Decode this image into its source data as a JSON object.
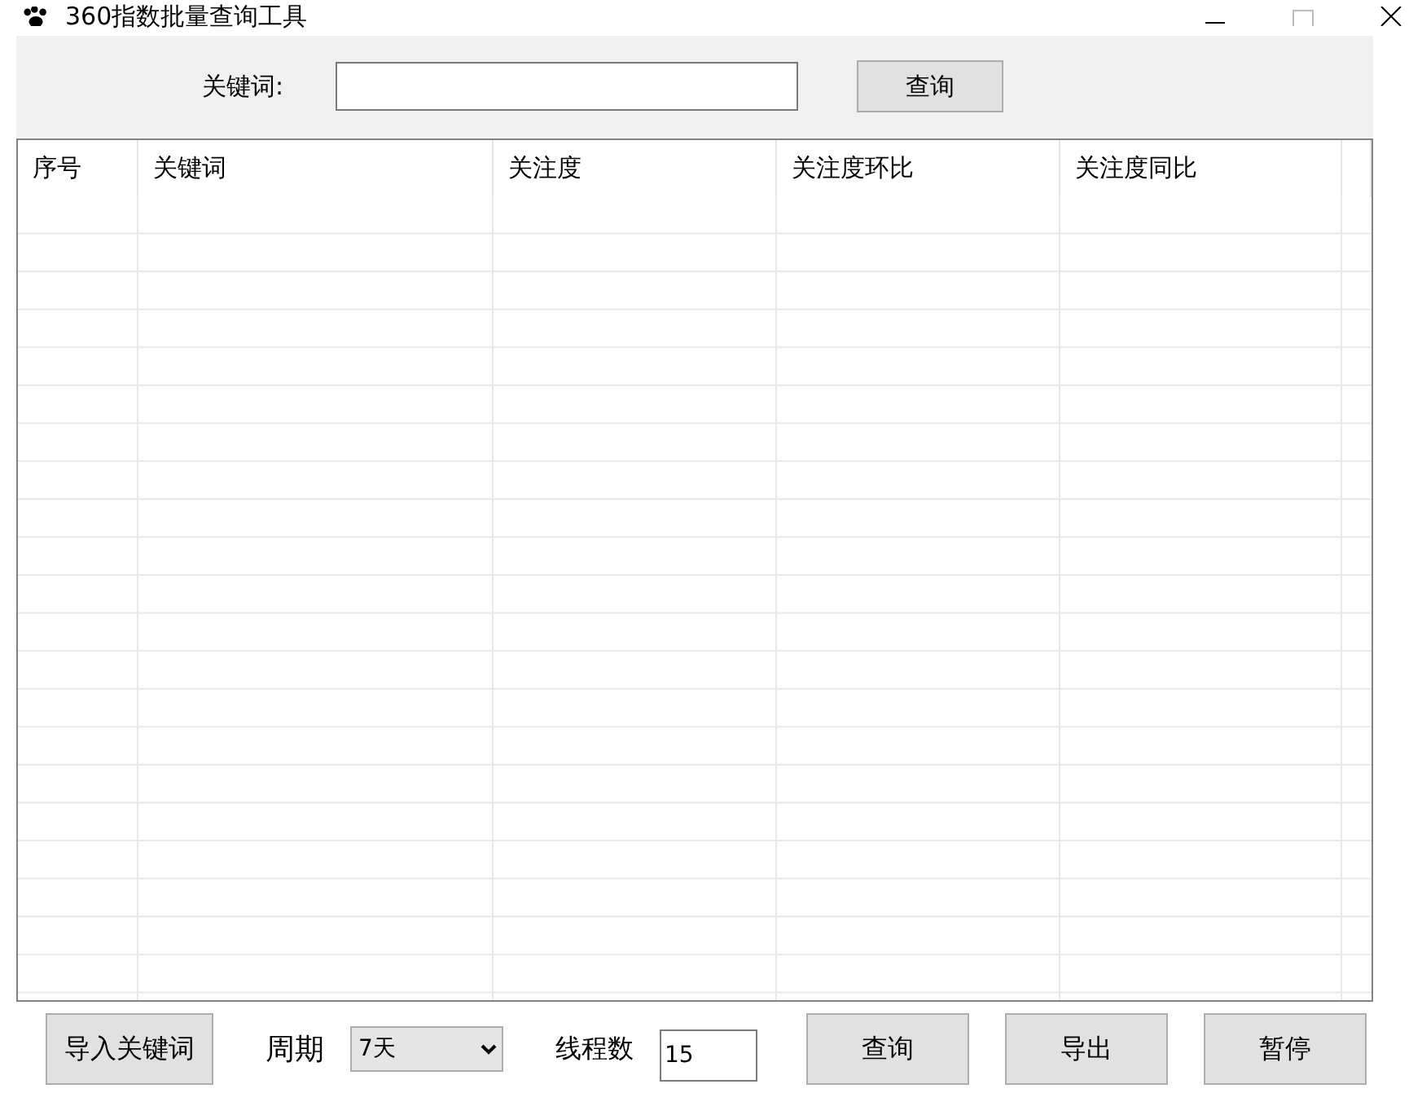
{
  "window": {
    "title": "360指数批量查询工具"
  },
  "search": {
    "label": "关键词:",
    "button": "查询"
  },
  "table": {
    "columns": [
      "序号",
      "关键词",
      "关注度",
      "关注度环比",
      "关注度同比"
    ]
  },
  "bottom_bar": {
    "import_button": "导入关键词",
    "period_label": "周期",
    "period_value": "7天",
    "threads_label": "线程数",
    "threads_value": "15",
    "buttons": [
      "查询",
      "导出",
      "暂停"
    ]
  }
}
